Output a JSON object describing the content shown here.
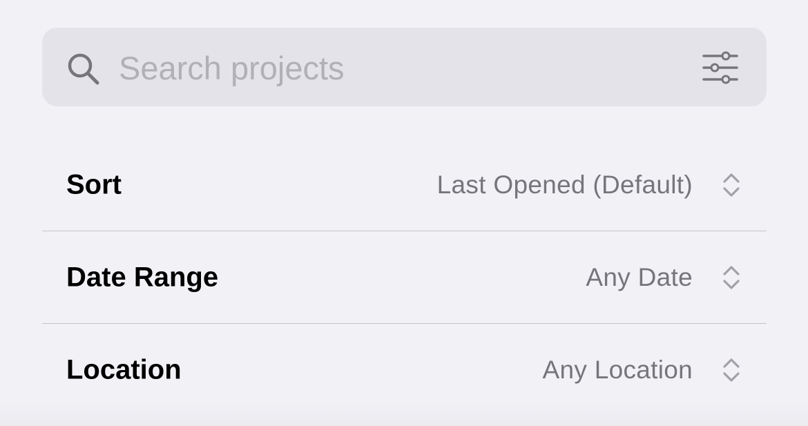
{
  "colors": {
    "background": "#f2f1f6",
    "search_background": "#e4e3e9",
    "placeholder": "#b1b0b6",
    "icon_gray": "#76757b",
    "divider": "#c5c4ca",
    "label": "#000000",
    "value": "#76757b"
  },
  "search": {
    "icon": "search-icon",
    "placeholder": "Search projects",
    "value": "",
    "filter_icon": "sliders-icon"
  },
  "filters": [
    {
      "label": "Sort",
      "value": "Last Opened (Default)",
      "icon": "chevron-updown-icon"
    },
    {
      "label": "Date Range",
      "value": "Any Date",
      "icon": "chevron-updown-icon"
    },
    {
      "label": "Location",
      "value": "Any Location",
      "icon": "chevron-updown-icon"
    }
  ]
}
